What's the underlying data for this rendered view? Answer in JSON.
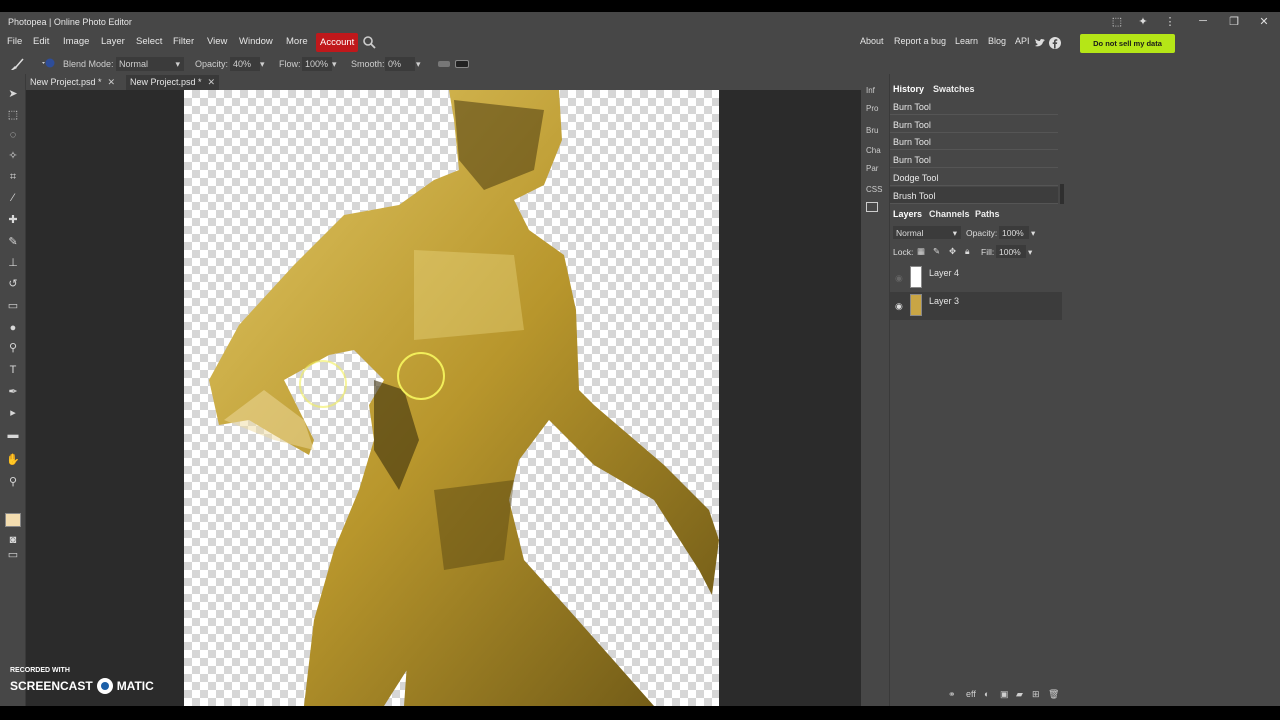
{
  "window": {
    "title": "Photopea | Online Photo Editor",
    "controls": [
      "⬚",
      "✦",
      "⋮",
      "─",
      "❐",
      "✕"
    ]
  },
  "menu": {
    "items": [
      "File",
      "Edit",
      "Image",
      "Layer",
      "Select",
      "Filter",
      "View",
      "Window",
      "More"
    ],
    "account": "Account",
    "right_links": [
      "About",
      "Report a bug",
      "Learn",
      "Blog",
      "API"
    ],
    "dns_button": "Do not sell my data"
  },
  "options": {
    "blend_label": "Blend Mode:",
    "blend_value": "Normal",
    "opacity_label": "Opacity:",
    "opacity_value": "40%",
    "flow_label": "Flow:",
    "flow_value": "100%",
    "smooth_label": "Smooth:",
    "smooth_value": "0%"
  },
  "tabs": [
    {
      "label": "New Project.psd *"
    },
    {
      "label": "New Project.psd *"
    }
  ],
  "side_tabs": [
    "Inf",
    "Pro",
    "Bru",
    "Cha",
    "Par",
    "CSS"
  ],
  "history_panel": {
    "tabs": [
      "History",
      "Swatches"
    ],
    "items": [
      "Burn Tool",
      "Burn Tool",
      "Burn Tool",
      "Burn Tool",
      "Dodge Tool",
      "Brush Tool"
    ]
  },
  "layers_panel": {
    "tabs": [
      "Layers",
      "Channels",
      "Paths"
    ],
    "blend": "Normal",
    "opacity_label": "Opacity:",
    "opacity_value": "100%",
    "lock_label": "Lock:",
    "fill_label": "Fill:",
    "fill_value": "100%",
    "layers": [
      {
        "name": "Layer 4"
      },
      {
        "name": "Layer 3"
      }
    ]
  },
  "watermark": {
    "line1": "RECORDED WITH",
    "brand_left": "SCREENCAST",
    "brand_right": "MATIC"
  },
  "colors": {
    "accent_account": "#c0181b",
    "dns_button": "#b5e617",
    "figure": "#c9a93a"
  }
}
